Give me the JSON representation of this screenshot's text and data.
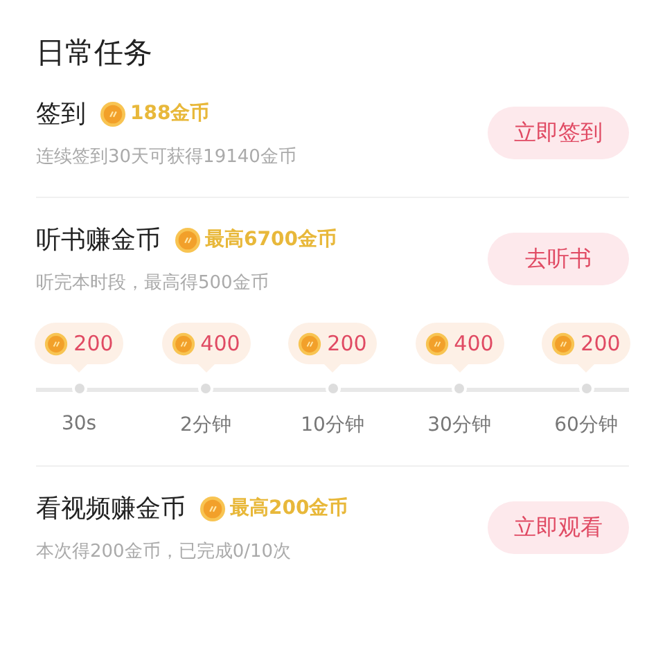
{
  "title": "日常任务",
  "tasks": [
    {
      "title": "签到",
      "reward": "188金币",
      "description": "连续签到30天可获得19140金币",
      "button": "立即签到"
    },
    {
      "title": "听书赚金币",
      "reward": "最高6700金币",
      "description": "听完本时段，最高得500金币",
      "button": "去听书",
      "milestones": [
        {
          "coins": "200",
          "time": "30s"
        },
        {
          "coins": "400",
          "time": "2分钟"
        },
        {
          "coins": "200",
          "time": "10分钟"
        },
        {
          "coins": "400",
          "time": "30分钟"
        },
        {
          "coins": "200",
          "time": "60分钟"
        }
      ]
    },
    {
      "title": "看视频赚金币",
      "reward": "最高200金币",
      "description": "本次得200金币，已完成0/10次",
      "button": "立即观看"
    }
  ]
}
